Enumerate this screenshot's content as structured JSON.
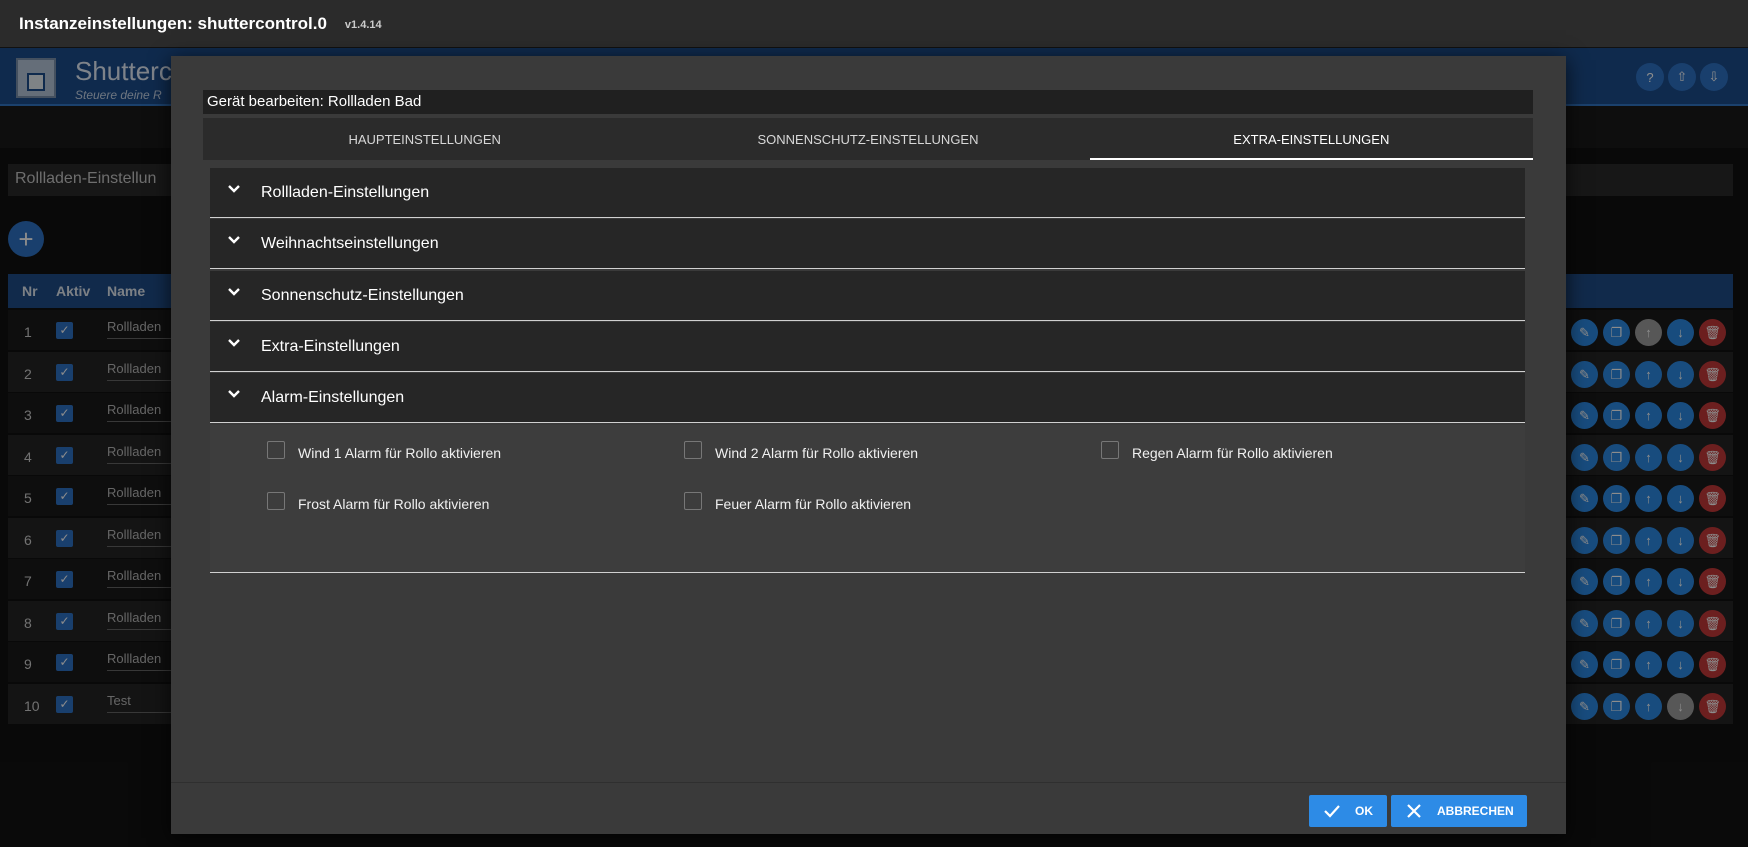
{
  "topbar": {
    "title": "Instanzeinstellungen: shuttercontrol.0",
    "version": "v1.4.14"
  },
  "app": {
    "name": "Shutterco",
    "subtitle": "Steuere deine R",
    "section_title": "Rollladen-Einstellun"
  },
  "table": {
    "headers": {
      "nr": "Nr",
      "aktiv": "Aktiv",
      "name": "Name"
    },
    "rows": [
      {
        "nr": "1",
        "name": "Rollladen"
      },
      {
        "nr": "2",
        "name": "Rollladen"
      },
      {
        "nr": "3",
        "name": "Rollladen"
      },
      {
        "nr": "4",
        "name": "Rollladen"
      },
      {
        "nr": "5",
        "name": "Rollladen"
      },
      {
        "nr": "6",
        "name": "Rollladen"
      },
      {
        "nr": "7",
        "name": "Rollladen"
      },
      {
        "nr": "8",
        "name": "Rollladen"
      },
      {
        "nr": "9",
        "name": "Rollladen"
      },
      {
        "nr": "10",
        "name": "Test"
      }
    ]
  },
  "dialog": {
    "title": "Gerät bearbeiten: Rollladen Bad",
    "tabs": [
      "HAUPTEINSTELLUNGEN",
      "SONNENSCHUTZ-EINSTELLUNGEN",
      "EXTRA-EINSTELLUNGEN"
    ],
    "active_tab": "EXTRA-EINSTELLUNGEN",
    "sections": [
      "Rollladen-Einstellungen",
      "Weihnachtseinstellungen",
      "Sonnenschutz-Einstellungen",
      "Extra-Einstellungen",
      "Alarm-Einstellungen"
    ],
    "alarm_checkboxes": [
      "Wind 1 Alarm für Rollo aktivieren",
      "Wind 2 Alarm für Rollo aktivieren",
      "Regen Alarm für Rollo aktivieren",
      "Frost Alarm für Rollo aktivieren",
      "Feuer Alarm für Rollo aktivieren"
    ],
    "ok_label": "OK",
    "cancel_label": "ABBRECHEN"
  },
  "colors": {
    "accent": "#2d8be6",
    "header_blue": "#1d4e8d",
    "danger": "#c53a3a",
    "disabled": "#9e9e9e"
  }
}
